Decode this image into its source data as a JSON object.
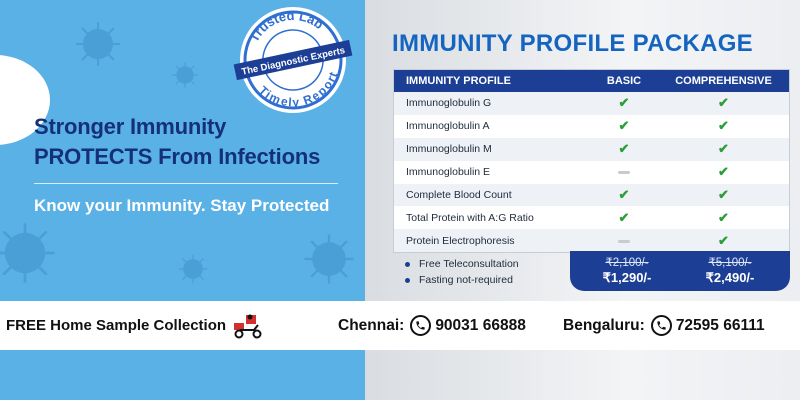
{
  "badge": {
    "arc_top": "Trusted Lab",
    "band": "The Diagnostic Experts",
    "arc_bottom": "Timely Report"
  },
  "hero": {
    "line1": "Stronger Immunity",
    "line2": "PROTECTS From Infections",
    "tagline": "Know your Immunity. Stay Protected"
  },
  "package": {
    "title": "IMMUNITY PROFILE PACKAGE",
    "columns": [
      "IMMUNITY PROFILE",
      "BASIC",
      "COMPREHENSIVE"
    ],
    "rows": [
      {
        "name": "Immunoglobulin G",
        "basic": true,
        "comprehensive": true
      },
      {
        "name": "Immunoglobulin A",
        "basic": true,
        "comprehensive": true
      },
      {
        "name": "Immunoglobulin M",
        "basic": true,
        "comprehensive": true
      },
      {
        "name": "Immunoglobulin E",
        "basic": false,
        "comprehensive": true
      },
      {
        "name": "Complete Blood Count",
        "basic": true,
        "comprehensive": true
      },
      {
        "name": "Total Protein with A:G Ratio",
        "basic": true,
        "comprehensive": true
      },
      {
        "name": "Protein Electrophoresis",
        "basic": false,
        "comprehensive": true
      }
    ],
    "features": [
      "Free Teleconsultation",
      "Fasting not-required"
    ],
    "prices": {
      "basic": {
        "old": "₹2,100/-",
        "new": "₹1,290/-"
      },
      "comprehensive": {
        "old": "₹5,100/-",
        "new": "₹2,490/-"
      }
    }
  },
  "footer": {
    "home_collection": "FREE Home Sample Collection",
    "chennai_label": "Chennai:",
    "chennai_phone": "90031 66888",
    "bengaluru_label": "Bengaluru:",
    "bengaluru_phone": "72595 66111"
  },
  "colors": {
    "sky": "#5ab1e6",
    "navy": "#1c3f95",
    "title_blue": "#1565c0",
    "check_green": "#2e9e3a"
  },
  "icons": [
    "check-icon",
    "dash-icon",
    "phone-icon",
    "delivery-scooter-icon",
    "virus-icon"
  ]
}
